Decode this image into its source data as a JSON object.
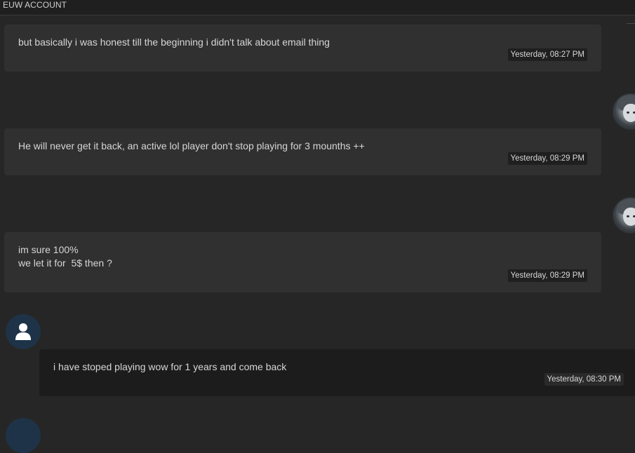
{
  "header": {
    "title": "EUW ACCOUNT"
  },
  "messages": [
    {
      "text": "but basically i was honest till the beginning i didn't talk about email thing",
      "time": "Yesterday, 08:27 PM",
      "sender": "other"
    },
    {
      "text": "He will never get it back, an active lol player don't stop playing for 3 mounths ++",
      "time": "Yesterday, 08:29 PM",
      "sender": "other"
    },
    {
      "text": "im sure 100%\nwe let it for  5$ then ?",
      "time": "Yesterday, 08:29 PM",
      "sender": "other"
    },
    {
      "text": "i have stoped playing wow for 1 years and come back",
      "time": "Yesterday, 08:30 PM",
      "sender": "me"
    }
  ],
  "icons": {
    "other_avatar": "anime-character-avatar",
    "my_avatar": "user-silhouette-icon"
  },
  "colors": {
    "background": "#262626",
    "bubble_other": "#303030",
    "bubble_me": "#1c1c1c",
    "avatar_user_bg": "#1e3347"
  }
}
